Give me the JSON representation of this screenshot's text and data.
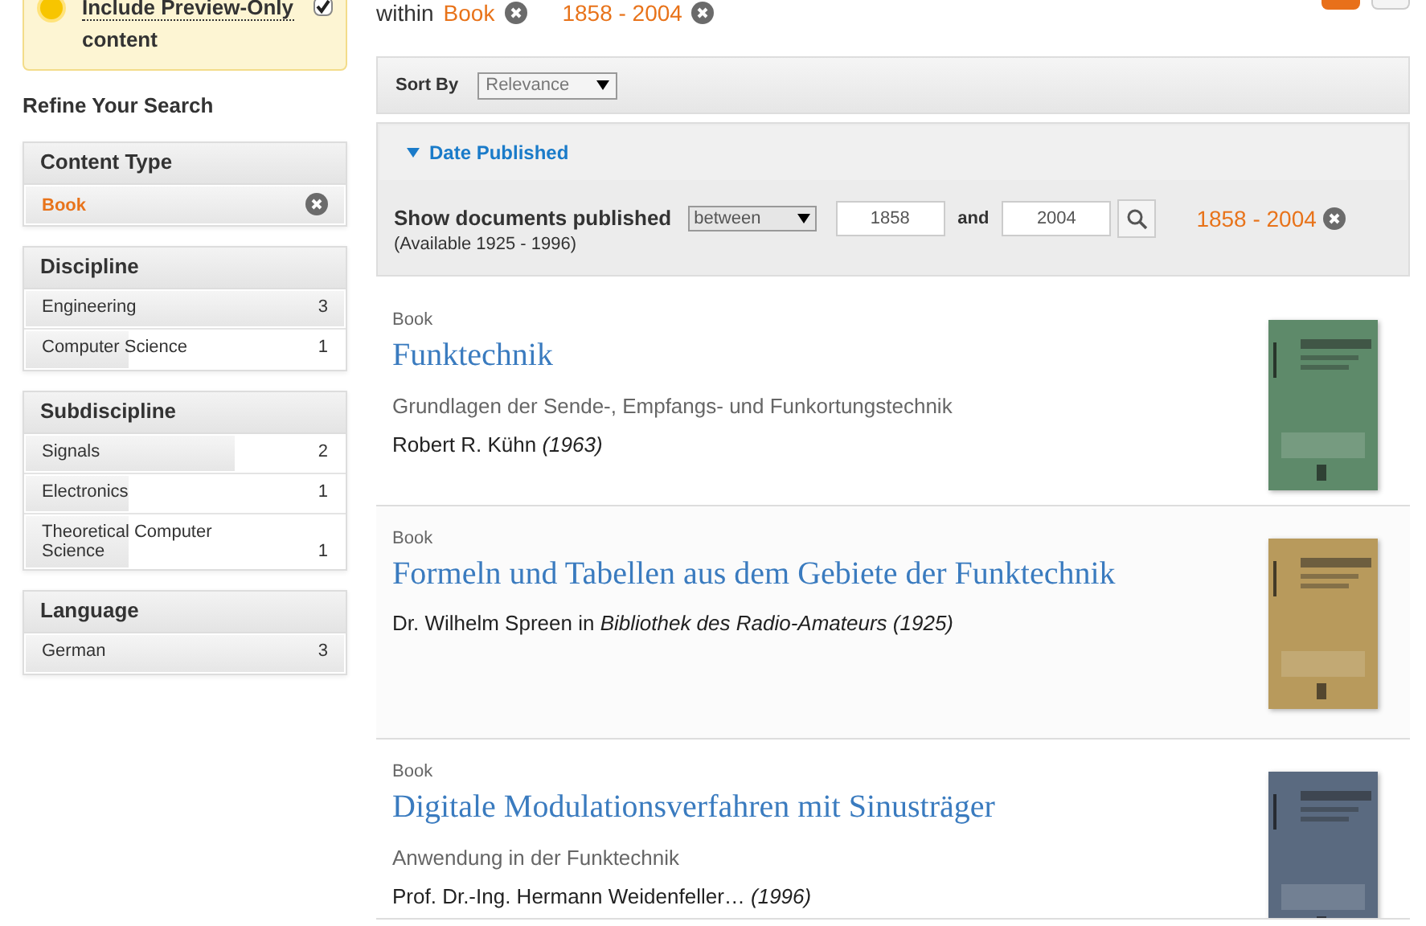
{
  "preview_filter": {
    "label": "Include Preview-Only",
    "label_rest": "content",
    "checked": true
  },
  "refine_title": "Refine Your Search",
  "facets": [
    {
      "title": "Content Type",
      "items": [
        {
          "label": "Book",
          "selected": true,
          "level": 1
        }
      ]
    },
    {
      "title": "Discipline",
      "items": [
        {
          "label": "Engineering",
          "count": "3",
          "selected": false,
          "level": 1
        },
        {
          "label": "Computer Science",
          "count": "1",
          "selected": false,
          "level": 0.33
        }
      ]
    },
    {
      "title": "Subdiscipline",
      "items": [
        {
          "label": "Signals",
          "count": "2",
          "selected": false,
          "level": 0.66
        },
        {
          "label": "Electronics",
          "count": "1",
          "selected": false,
          "level": 0.33
        },
        {
          "label": "Theoretical Computer Science",
          "count": "1",
          "selected": false,
          "level": 0.33
        }
      ]
    },
    {
      "title": "Language",
      "items": [
        {
          "label": "German",
          "count": "3",
          "selected": false,
          "level": 1
        }
      ]
    }
  ],
  "filters": {
    "prefix": "within",
    "active": [
      "Book",
      "1858 - 2004"
    ]
  },
  "sort": {
    "label": "Sort By",
    "value": "Relevance"
  },
  "date_panel": {
    "title": "Date Published",
    "expanded": true,
    "label": "Show documents published",
    "mode": "between",
    "from": "1858",
    "joiner": "and",
    "to": "2004",
    "available": "(Available 1925 - 1996)",
    "active": "1858 - 2004"
  },
  "results": [
    {
      "type": "Book",
      "title": "Funktechnik",
      "subtitle": "Grundlagen der Sende-, Empfangs- und Funkortungstechnik",
      "author": "Robert R. Kühn",
      "year": "(1963)"
    },
    {
      "type": "Book",
      "title": "Formeln und Tabellen aus dem Gebiete der Funktechnik",
      "author": "Dr. Wilhelm Spreen",
      "in": "in",
      "series": "Bibliothek des Radio-Amateurs",
      "year": "(1925)"
    },
    {
      "type": "Book",
      "title": "Digitale Modulationsverfahren mit Sinusträger",
      "subtitle": "Anwendung in der Funktechnik",
      "author": "Prof. Dr.-Ing. Hermann Weidenfeller…",
      "year": "(1996)"
    }
  ]
}
